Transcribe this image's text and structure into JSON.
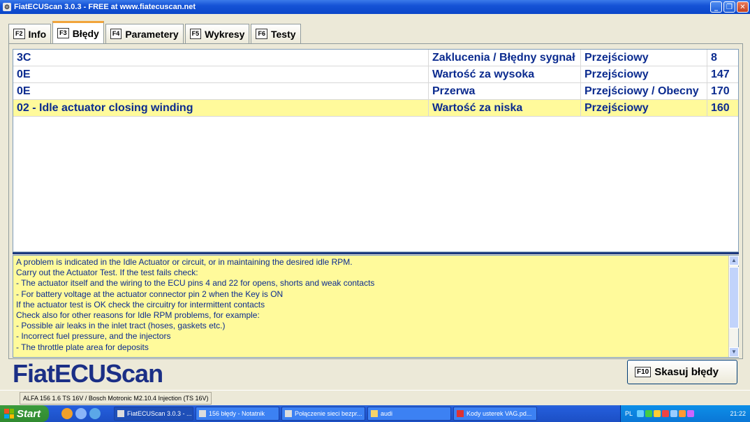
{
  "window": {
    "title": "FiatECUScan 3.0.3 - FREE at www.fiatecuscan.net"
  },
  "tabs": [
    {
      "key": "F2",
      "label": "Info"
    },
    {
      "key": "F3",
      "label": "Błędy"
    },
    {
      "key": "F4",
      "label": "Parametery"
    },
    {
      "key": "F5",
      "label": "Wykresy"
    },
    {
      "key": "F6",
      "label": "Testy"
    }
  ],
  "errors": [
    {
      "code": "3C",
      "desc": "Zaklucenia / Błędny sygnał",
      "status": "Przejściowy",
      "count": "8"
    },
    {
      "code": "0E",
      "desc": "Wartość za wysoka",
      "status": "Przejściowy",
      "count": "147"
    },
    {
      "code": "0E",
      "desc": "Przerwa",
      "status": "Przejściowy / Obecny",
      "count": "170"
    },
    {
      "code": "02 - Idle actuator closing winding",
      "desc": "Wartość za niska",
      "status": "Przejściowy",
      "count": "160"
    }
  ],
  "description_lines": [
    "A problem is indicated in the Idle Actuator or circuit, or in maintaining the desired idle RPM.",
    "Carry out the Actuator Test. If the test fails check:",
    "- The actuator itself and the wiring to the ECU pins 4 and 22 for opens, shorts and weak contacts",
    "- For battery voltage at the actuator connector pin 2 when the Key is ON",
    "If the actuator test is OK check the circuitry for intermittent contacts",
    "Check also for other reasons for Idle RPM problems, for example:",
    "- Possible air leaks in the inlet tract (hoses, gaskets etc.)",
    "- Incorrect fuel pressure, and the injectors",
    "- The throttle plate area for deposits"
  ],
  "logo": "FiatECUScan",
  "clear_button": {
    "key": "F10",
    "label": "Skasuj błędy"
  },
  "status": "ALFA 156 1.6 TS 16V / Bosch Motronic M2.10.4 Injection (TS 16V)",
  "taskbar": {
    "start": "Start",
    "tasks": [
      "FiatECUScan 3.0.3 - ...",
      "156 błędy - Notatnik",
      "Połączenie sieci bezpr...",
      "audi",
      "Kody usterek VAG.pd..."
    ],
    "lang": "PL",
    "clock": "21:22"
  }
}
